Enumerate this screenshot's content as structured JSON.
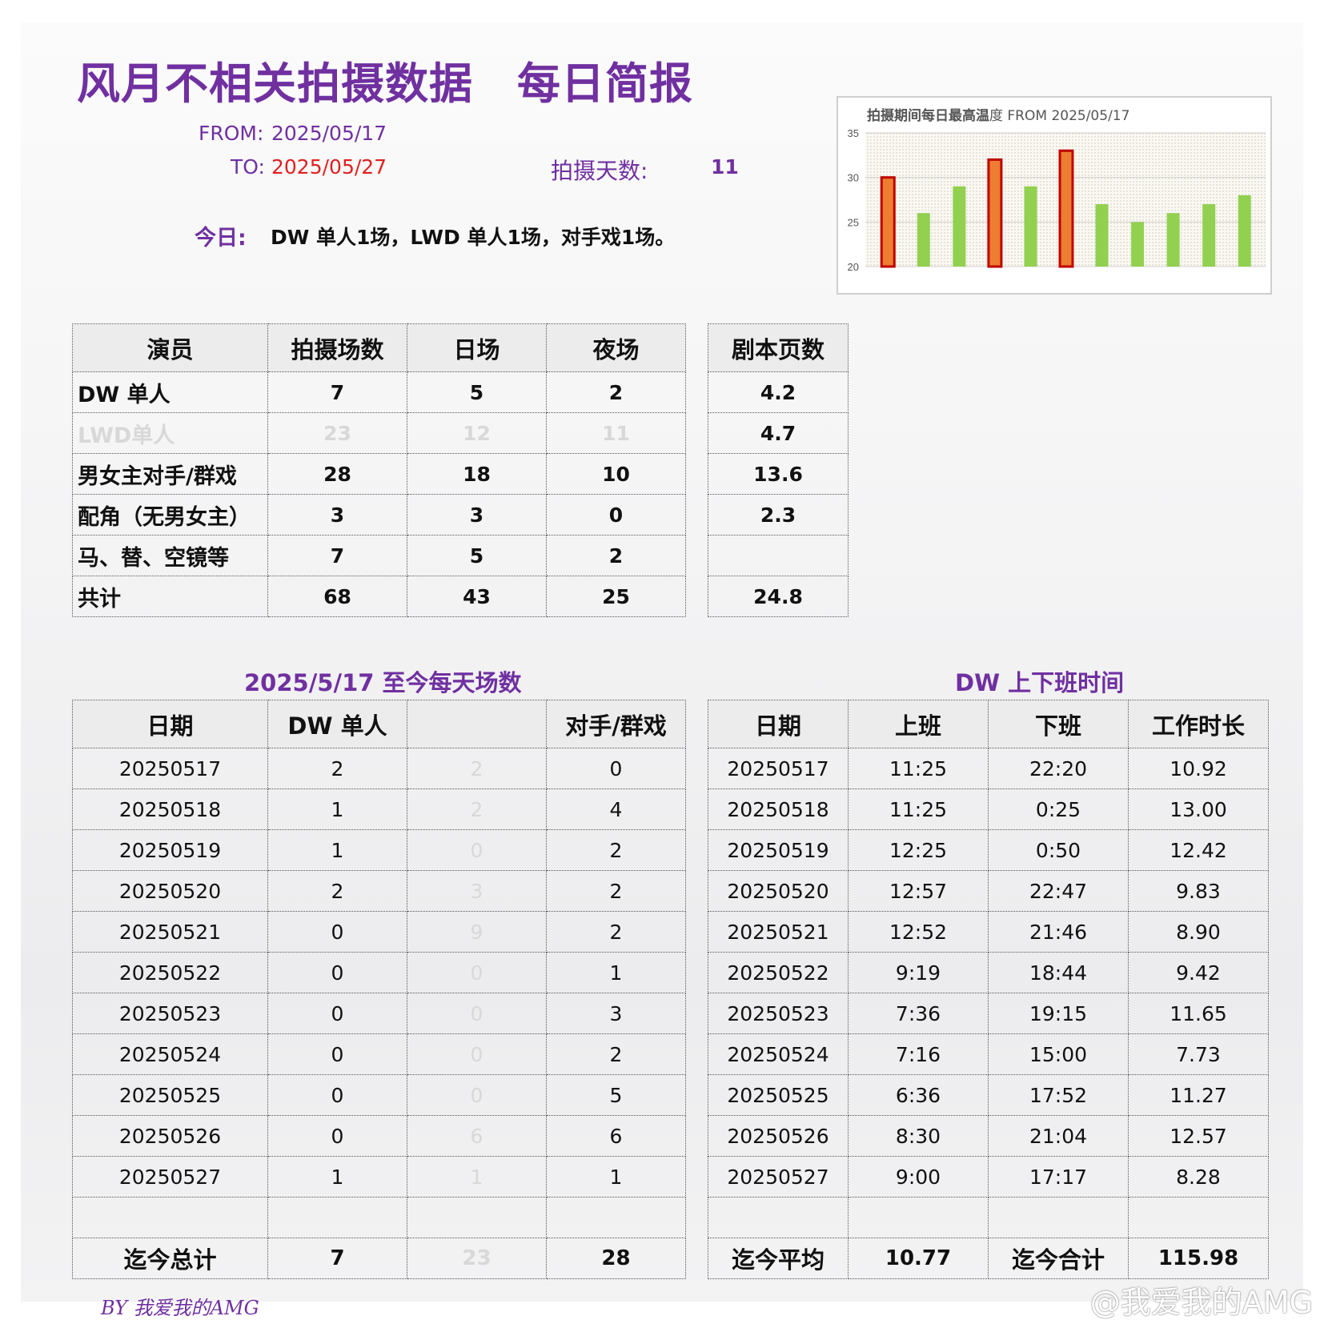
{
  "header": {
    "title": "风月不相关拍摄数据　每日简报",
    "from_label": "FROM:",
    "from_value": "2025/05/17",
    "to_label": "TO:",
    "to_value": "2025/05/27",
    "days_label": "拍摄天数:",
    "days_value": "11",
    "today_label": "今日:",
    "today_text": "DW 单人1场，LWD 单人1场，对手戏1场。"
  },
  "summary": {
    "headers": [
      "演员",
      "拍摄场数",
      "日场",
      "夜场",
      "剧本页数"
    ],
    "rows": [
      [
        "DW 单人",
        "7",
        "5",
        "2",
        "4.2"
      ],
      [
        "LWD单人",
        "23",
        "12",
        "11",
        "4.7"
      ],
      [
        "男女主对手/群戏",
        "28",
        "18",
        "10",
        "13.6"
      ],
      [
        "配角（无男女主）",
        "3",
        "3",
        "0",
        "2.3"
      ],
      [
        "马、替、空镜等",
        "7",
        "5",
        "2",
        ""
      ],
      [
        "共计",
        "68",
        "43",
        "25",
        "24.8"
      ]
    ]
  },
  "daily": {
    "title": "2025/5/17 至今每天场数",
    "headers": [
      "日期",
      "DW 单人",
      "",
      "对手/群戏"
    ],
    "rows": [
      [
        "20250517",
        "2",
        "2",
        "0"
      ],
      [
        "20250518",
        "1",
        "2",
        "4"
      ],
      [
        "20250519",
        "1",
        "0",
        "2"
      ],
      [
        "20250520",
        "2",
        "3",
        "2"
      ],
      [
        "20250521",
        "0",
        "9",
        "2"
      ],
      [
        "20250522",
        "0",
        "0",
        "1"
      ],
      [
        "20250523",
        "0",
        "0",
        "3"
      ],
      [
        "20250524",
        "0",
        "0",
        "2"
      ],
      [
        "20250525",
        "0",
        "0",
        "5"
      ],
      [
        "20250526",
        "0",
        "6",
        "6"
      ],
      [
        "20250527",
        "1",
        "1",
        "1"
      ]
    ],
    "total": [
      "迄今总计",
      "7",
      "23",
      "28"
    ]
  },
  "worktime": {
    "title": "DW 上下班时间",
    "headers": [
      "日期",
      "上班",
      "下班",
      "工作时长"
    ],
    "rows": [
      [
        "20250517",
        "11:25",
        "22:20",
        "10.92"
      ],
      [
        "20250518",
        "11:25",
        "0:25",
        "13.00"
      ],
      [
        "20250519",
        "12:25",
        "0:50",
        "12.42"
      ],
      [
        "20250520",
        "12:57",
        "22:47",
        "9.83"
      ],
      [
        "20250521",
        "12:52",
        "21:46",
        "8.90"
      ],
      [
        "20250522",
        "9:19",
        "18:44",
        "9.42"
      ],
      [
        "20250523",
        "7:36",
        "19:15",
        "11.65"
      ],
      [
        "20250524",
        "7:16",
        "15:00",
        "7.73"
      ],
      [
        "20250525",
        "6:36",
        "17:52",
        "11.27"
      ],
      [
        "20250526",
        "8:30",
        "21:04",
        "12.57"
      ],
      [
        "20250527",
        "9:00",
        "17:17",
        "8.28"
      ]
    ],
    "total": [
      "迄今平均",
      "10.77",
      "迄今合计",
      "115.98"
    ]
  },
  "chart_data": {
    "type": "bar",
    "title_bold": "拍摄期间每日最高温",
    "title_rest": "度 FROM 2025/05/17",
    "ylim": [
      20,
      35
    ],
    "yticks": [
      "20",
      "25",
      "30",
      "35"
    ],
    "values": [
      30,
      26,
      29,
      32,
      29,
      33,
      27,
      25,
      26,
      27,
      28
    ],
    "highlighted": [
      true,
      false,
      false,
      true,
      false,
      true,
      false,
      false,
      false,
      false,
      false
    ],
    "colors": {
      "normal": "#92d050",
      "highlight": "#ed7d31",
      "highlight_border": "#c00000"
    }
  },
  "footer": {
    "byline": "BY 我爱我的AMG",
    "watermark": "@我爱我的AMG"
  }
}
